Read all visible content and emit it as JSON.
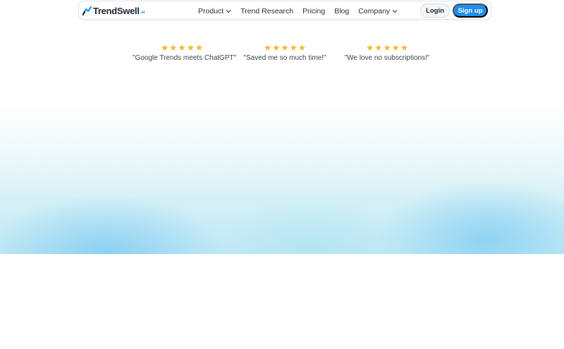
{
  "brand": {
    "name": "TrendSwell",
    "suffix": ".ai",
    "accent_color": "#1e8ef0",
    "star_color": "#f5b731"
  },
  "nav": {
    "items": [
      {
        "label": "Product",
        "has_dropdown": true
      },
      {
        "label": "Trend Research",
        "has_dropdown": false
      },
      {
        "label": "Pricing",
        "has_dropdown": false
      },
      {
        "label": "Blog",
        "has_dropdown": false
      },
      {
        "label": "Company",
        "has_dropdown": true
      }
    ],
    "login_label": "Login",
    "signup_label": "Sign up"
  },
  "testimonials": [
    {
      "rating": 5,
      "quote": "\"Google Trends meets ChatGPT\""
    },
    {
      "rating": 5,
      "quote": "\"Saved me so much time!\""
    },
    {
      "rating": 5,
      "quote": "\"We love no subscriptions!\""
    }
  ]
}
